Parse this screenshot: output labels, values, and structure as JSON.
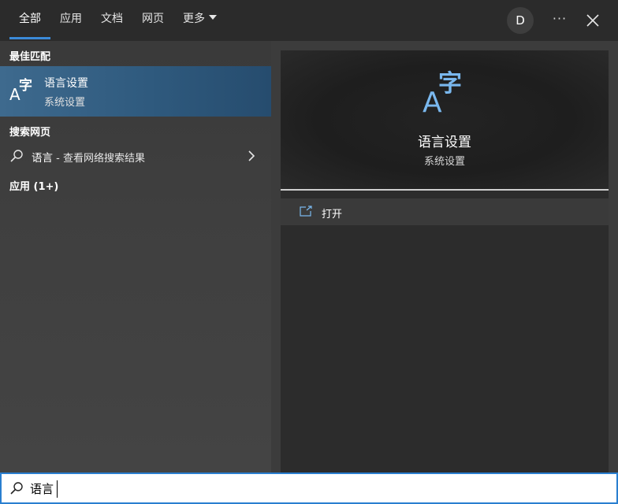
{
  "tabs": [
    {
      "label": "全部"
    },
    {
      "label": "应用"
    },
    {
      "label": "文档"
    },
    {
      "label": "网页"
    },
    {
      "label": "更多"
    }
  ],
  "header": {
    "avatar_initial": "D",
    "more_label": "···"
  },
  "sections": {
    "best_match": "最佳匹配",
    "web_search": "搜索网页",
    "apps": "应用 (1+)"
  },
  "best_match_item": {
    "title": "语言设置",
    "subtitle": "系统设置",
    "icon": "language-settings-icon"
  },
  "web_search_item": {
    "query": "语言",
    "suffix": " - 查看网络搜索结果",
    "icon": "search-icon"
  },
  "preview": {
    "title": "语言设置",
    "subtitle": "系统设置",
    "icon": "language-settings-icon"
  },
  "actions": {
    "open_label": "打开",
    "open_icon": "open-icon"
  },
  "search": {
    "value": "语言",
    "icon": "search-icon"
  },
  "colors": {
    "accent": "#3b8ad8",
    "icon_blue": "#7ab8ee",
    "selected_bg": "#2f5a7e"
  }
}
